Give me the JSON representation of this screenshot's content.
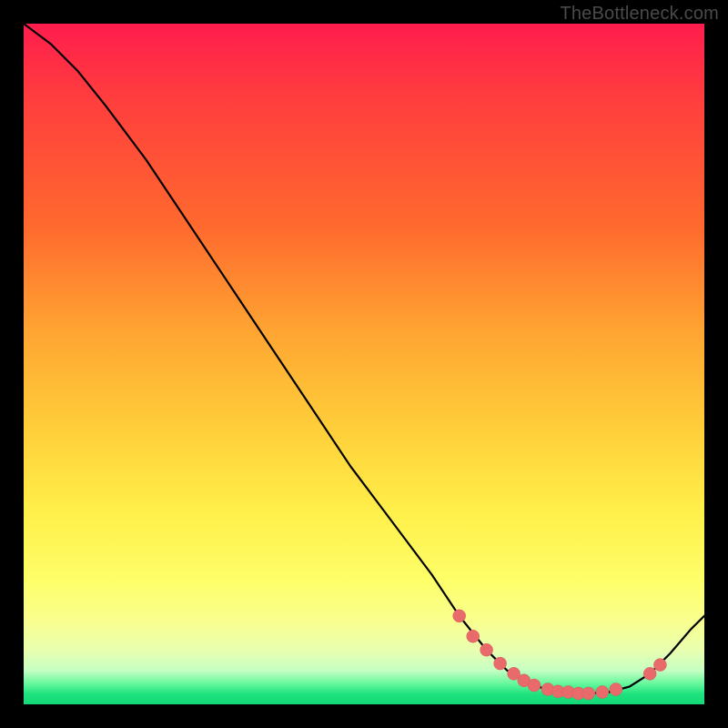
{
  "watermark": "TheBottleneck.com",
  "colors": {
    "dot": "#e86a6a",
    "curve": "#000000"
  },
  "chart_data": {
    "type": "line",
    "title": "",
    "xlabel": "",
    "ylabel": "",
    "xlim": [
      0,
      100
    ],
    "ylim": [
      0,
      100
    ],
    "grid": false,
    "legend": false,
    "series": [
      {
        "name": "curve",
        "x": [
          0,
          4,
          8,
          12,
          18,
          24,
          30,
          36,
          42,
          48,
          54,
          60,
          64,
          68,
          71,
          74,
          77,
          80,
          83,
          86,
          89,
          92,
          95,
          98,
          100
        ],
        "y": [
          100,
          97,
          93,
          88,
          80,
          71,
          62,
          53,
          44,
          35,
          27,
          19,
          13,
          8,
          5,
          3,
          2.2,
          1.8,
          1.6,
          1.8,
          2.6,
          4.5,
          7.5,
          11,
          13
        ]
      }
    ],
    "points": [
      {
        "x": 64,
        "y": 13
      },
      {
        "x": 66,
        "y": 10
      },
      {
        "x": 68,
        "y": 8
      },
      {
        "x": 70,
        "y": 6
      },
      {
        "x": 72,
        "y": 4.5
      },
      {
        "x": 73.5,
        "y": 3.5
      },
      {
        "x": 75,
        "y": 2.8
      },
      {
        "x": 77,
        "y": 2.2
      },
      {
        "x": 78.5,
        "y": 1.9
      },
      {
        "x": 80,
        "y": 1.8
      },
      {
        "x": 81.5,
        "y": 1.6
      },
      {
        "x": 83,
        "y": 1.6
      },
      {
        "x": 85,
        "y": 1.8
      },
      {
        "x": 87,
        "y": 2.2
      },
      {
        "x": 92,
        "y": 4.5
      },
      {
        "x": 93.5,
        "y": 5.8
      }
    ]
  }
}
